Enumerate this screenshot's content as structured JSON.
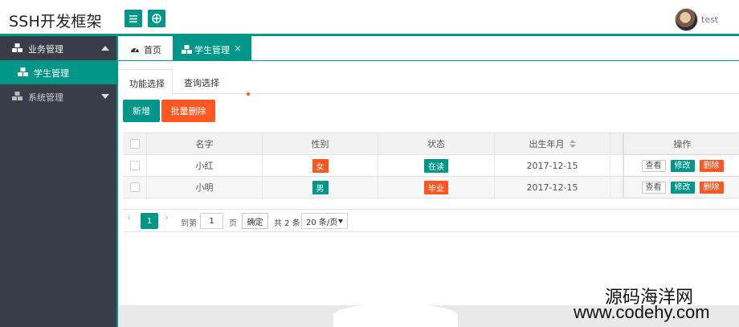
{
  "header": {
    "logo": "SSH开发框架",
    "menu_icon": "menu-icon",
    "globe_icon": "globe-icon",
    "username": "test"
  },
  "sidebar": {
    "groups": [
      {
        "label": "业务管理",
        "icon": "cubes-icon",
        "expanded": true,
        "children": [
          {
            "label": "学生管理",
            "icon": "cubes-icon",
            "active": true
          }
        ]
      },
      {
        "label": "系统管理",
        "icon": "cubes-icon",
        "expanded": false
      }
    ]
  },
  "tabs": [
    {
      "label": "首页",
      "icon": "dashboard-icon"
    },
    {
      "label": "学生管理",
      "icon": "cubes-icon",
      "active": true,
      "close": "×"
    }
  ],
  "subtabs": [
    {
      "label": "功能选择",
      "active": true
    },
    {
      "label": "查询选择"
    }
  ],
  "toolbar": {
    "add_label": "新增",
    "batch_delete_label": "批量删除"
  },
  "table": {
    "columns": [
      "名字",
      "性别",
      "状态",
      "出生年月",
      "操作"
    ],
    "rows": [
      {
        "name": "小红",
        "gender": "女",
        "status": "在读",
        "birth": "2017-12-15"
      },
      {
        "name": "小明",
        "gender": "男",
        "status": "毕业",
        "birth": "2017-12-15"
      }
    ],
    "actions": {
      "view": "查看",
      "edit": "修改",
      "delete": "删除"
    }
  },
  "pager": {
    "prev": "‹",
    "current": "1",
    "next": "›",
    "goto_label": "到第",
    "goto_value": "1",
    "page_label": "页",
    "confirm": "确定",
    "total": "共 2 条",
    "page_size": "20 条/页"
  },
  "watermark": {
    "line1": "源码海洋网",
    "line2": "www.codehy.com"
  },
  "colors": {
    "primary": "#009688",
    "danger": "#ff5722",
    "sidebar": "#393d49"
  }
}
